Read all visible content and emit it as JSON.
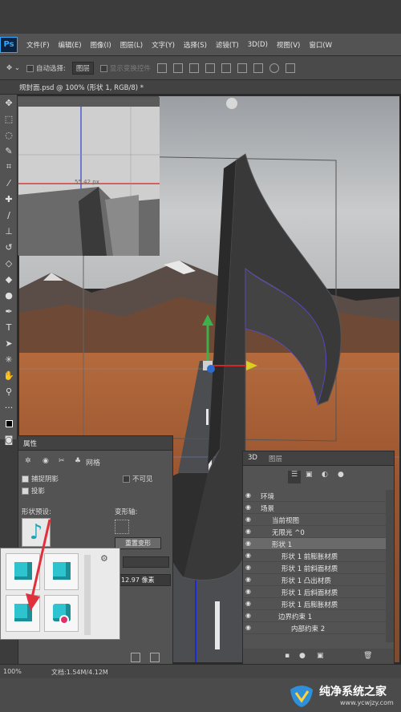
{
  "app": {
    "logo": "Ps"
  },
  "menu": [
    "文件(F)",
    "编辑(E)",
    "图像(I)",
    "图层(L)",
    "文字(Y)",
    "选择(S)",
    "滤镜(T)",
    "3D(D)",
    "视图(V)",
    "窗口(W"
  ],
  "options": {
    "auto_select_label": "自动选择:",
    "auto_select_value": "图层",
    "show_transform_label": "显示变换控件"
  },
  "document": {
    "tab_title": "规封面.psd @ 100% (形状 1, RGB/8) *",
    "ruler_readout": "55.42 px"
  },
  "status": {
    "zoom": "100%",
    "doc_info": "文档:1.54M/4.12M"
  },
  "watermark": {
    "title": "纯净系统之家",
    "url": "www.ycwjzy.com"
  },
  "properties": {
    "tab": "属性",
    "mode_tabs": [
      "网格"
    ],
    "catch_shadows": "捕捉阴影",
    "cast_shadows": "投影",
    "invisible": "不可见",
    "shape_presets_label": "形状预设:",
    "deform_axis_label": "变形轴:",
    "reset_deform": "重置变形",
    "extrusion_depth": "12.97 像素"
  },
  "panel3d": {
    "tabs": [
      "3D",
      "图层"
    ],
    "rows": [
      {
        "label": "环境",
        "indent": 0
      },
      {
        "label": "场景",
        "indent": 0
      },
      {
        "label": "当前视图",
        "indent": 1
      },
      {
        "label": "无限光 ^0",
        "indent": 1
      },
      {
        "label": "形状 1",
        "indent": 1,
        "selected": true
      },
      {
        "label": "形状 1 前膨胀材质",
        "indent": 2
      },
      {
        "label": "形状 1 前斜面材质",
        "indent": 2
      },
      {
        "label": "形状 1 凸出材质",
        "indent": 2
      },
      {
        "label": "形状 1 后斜面材质",
        "indent": 2
      },
      {
        "label": "形状 1 后膨胀材质",
        "indent": 2
      },
      {
        "label": "边界约束 1",
        "indent": 2
      },
      {
        "label": "内部约束 2",
        "indent": 3
      }
    ]
  },
  "colors": {
    "accent": "#31a8ff",
    "cube": "#2ec4cf",
    "arrow": "#e0303c"
  }
}
